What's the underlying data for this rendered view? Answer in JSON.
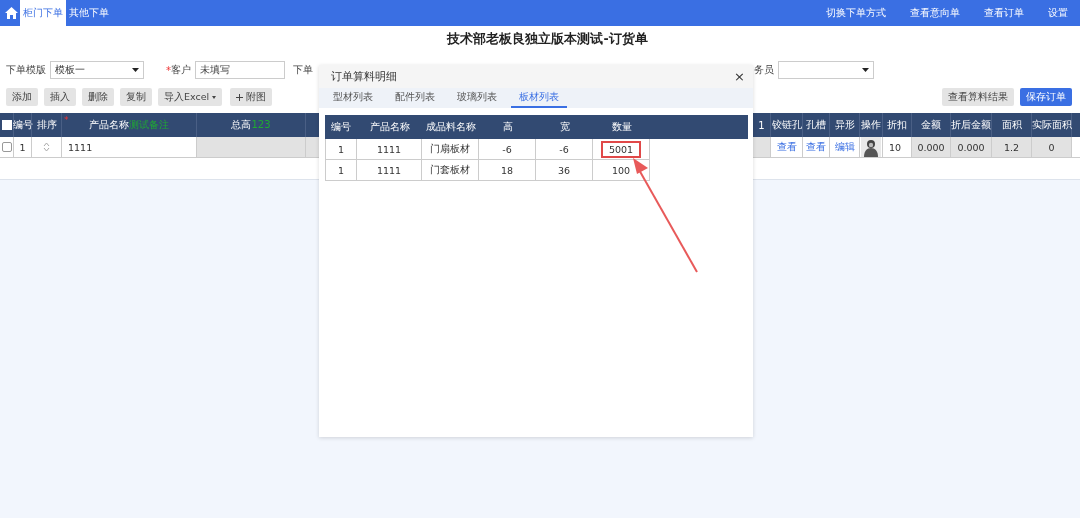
{
  "nav": {
    "tabs": [
      {
        "label": "柜门下单",
        "selected": true
      },
      {
        "label": "其他下单",
        "selected": false
      }
    ],
    "links": [
      "切换下单方式",
      "查看意向单",
      "查看订单",
      "设置"
    ]
  },
  "title": "技术部老板良独立版本测试-订货单",
  "form": {
    "template_label": "下单模版",
    "template_value": "模板一",
    "customer_required_mark": "*",
    "customer_label": "客户",
    "customer_value": "未填写",
    "order_label": "下单",
    "salesman_label": "务员"
  },
  "toolbar": {
    "buttons": [
      {
        "label": "添加",
        "kind": "plain"
      },
      {
        "label": "插入",
        "kind": "plain"
      },
      {
        "label": "删除",
        "kind": "plain"
      },
      {
        "label": "复制",
        "kind": "plain"
      },
      {
        "label": "导入Excel",
        "kind": "dropdown"
      },
      {
        "label": "附图",
        "kind": "add"
      }
    ],
    "right_buttons": [
      {
        "label": "查看算料结果",
        "primary": false
      },
      {
        "label": "保存订单",
        "primary": true
      }
    ]
  },
  "table": {
    "all_checked": false,
    "columns": [
      {
        "label": "编号"
      },
      {
        "label": "排序"
      },
      {
        "label": "产品名称",
        "note": "测试备注",
        "required_mark": "*"
      },
      {
        "label": "总高",
        "note": "123"
      },
      {
        "label": "1"
      },
      {
        "label": "铰链孔"
      },
      {
        "label": "孔槽"
      },
      {
        "label": "异形"
      },
      {
        "label": "操作"
      },
      {
        "label": "折扣"
      },
      {
        "label": "金额"
      },
      {
        "label": "折后金额"
      },
      {
        "label": "面积"
      },
      {
        "label": "实际面积"
      }
    ],
    "rows": [
      {
        "checked": false,
        "number": "1",
        "product": "1111",
        "hinge": "查看",
        "slot": "查看",
        "shape": "编辑",
        "discount": "10",
        "amount": "0.000",
        "discounted": "0.000",
        "area": "1.2",
        "actual_area": "0"
      }
    ]
  },
  "dialog": {
    "title": "订单算料明细",
    "close": "×",
    "tabs": [
      {
        "label": "型材列表",
        "selected": false
      },
      {
        "label": "配件列表",
        "selected": false
      },
      {
        "label": "玻璃列表",
        "selected": false
      },
      {
        "label": "板材列表",
        "selected": true
      }
    ],
    "columns": [
      "编号",
      "产品名称",
      "成品料名称",
      "高",
      "宽",
      "数量"
    ],
    "rows": [
      {
        "cells": [
          "1",
          "1111",
          "门扇板材",
          "-6",
          "-6",
          "5001"
        ],
        "quantity_marked": true
      },
      {
        "cells": [
          "1",
          "1111",
          "门套板材",
          "18",
          "36",
          "100"
        ],
        "quantity_marked": false
      }
    ]
  }
}
